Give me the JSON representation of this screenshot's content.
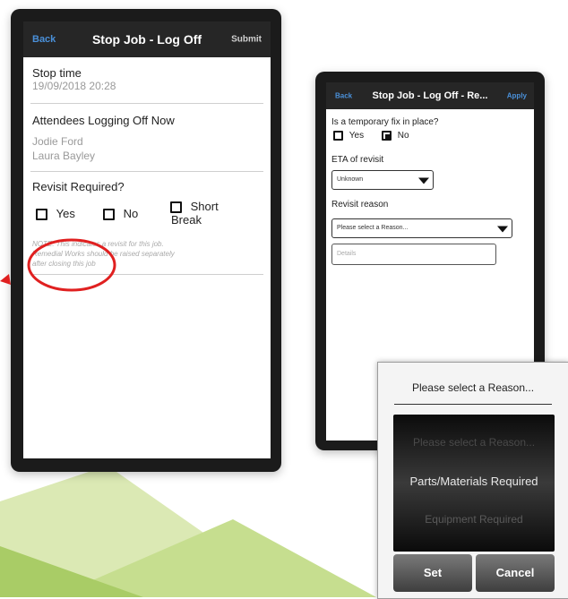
{
  "phone1": {
    "nav": {
      "back": "Back",
      "title": "Stop Job - Log Off",
      "action": "Submit"
    },
    "stop_time_label": "Stop time",
    "stop_time_value": "19/09/2018 20:28",
    "attendees_label": "Attendees Logging Off Now",
    "attendees": [
      "Jodie Ford",
      "Laura Bayley"
    ],
    "revisit_label": "Revisit Required?",
    "options": {
      "yes": "Yes",
      "no": "No",
      "short_break_1": "Short",
      "short_break_2": "Break"
    },
    "note": [
      "NOTE: This indicates a revisit for this job.",
      "Remedial Works should be raised separately",
      "after closing this job"
    ]
  },
  "phone2": {
    "nav": {
      "back": "Back",
      "title": "Stop Job - Log Off - Re...",
      "action": "Apply"
    },
    "temp_fix_label": "Is a temporary fix in place?",
    "temp_fix_yes": "Yes",
    "temp_fix_no": "No",
    "temp_fix_selected": "No",
    "eta_label": "ETA of revisit",
    "eta_value": "Unknown",
    "reason_label": "Revisit reason",
    "reason_value": "Please select a Reason...",
    "details_placeholder": "Details"
  },
  "picker": {
    "title": "Please select a Reason...",
    "options": [
      "Please select a Reason...",
      "Parts/Materials Required",
      "Equipment Required"
    ],
    "selected": "Parts/Materials Required",
    "set": "Set",
    "cancel": "Cancel"
  },
  "colors": {
    "accent_blue": "#4a90d9",
    "annotation_red": "#e02020",
    "deco_green": "#b9d67a"
  }
}
